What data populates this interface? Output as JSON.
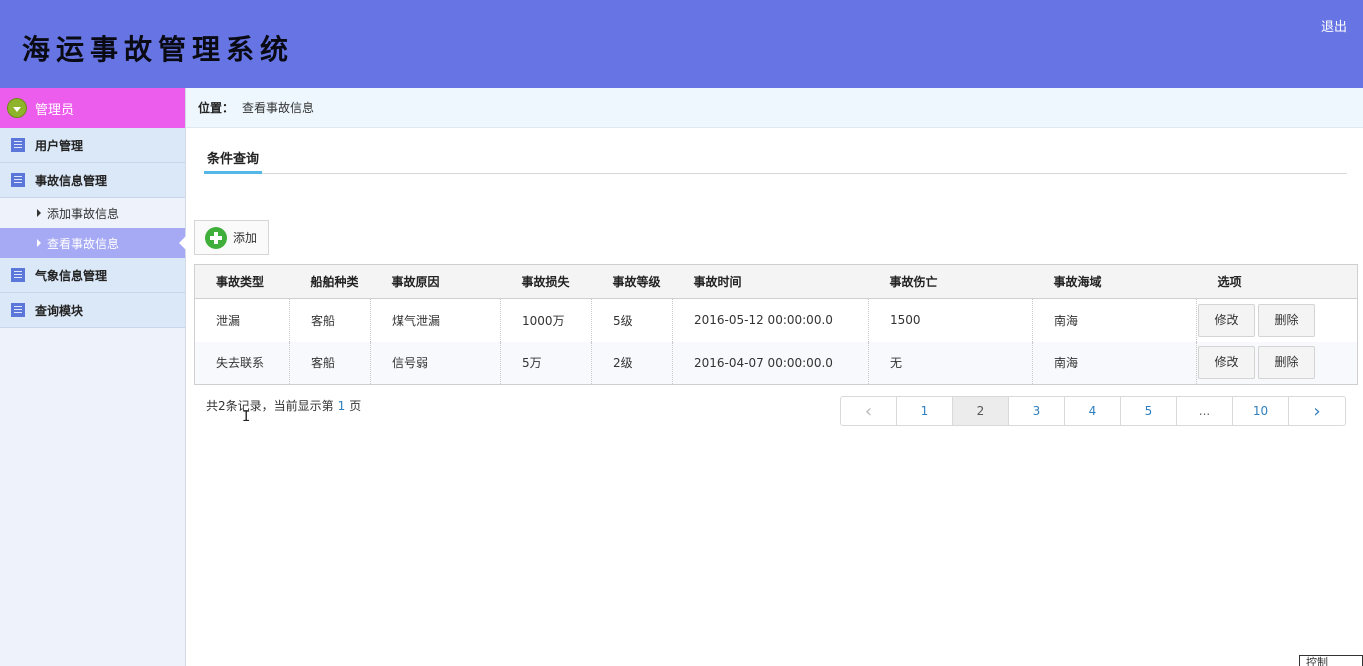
{
  "header": {
    "title": "海运事故管理系统",
    "logout": "退出"
  },
  "sidebar": {
    "user": "管理员",
    "menus": [
      {
        "label": "用户管理"
      },
      {
        "label": "事故信息管理"
      },
      {
        "label": "气象信息管理"
      },
      {
        "label": "查询模块"
      }
    ],
    "submenus": [
      {
        "label": "添加事故信息"
      },
      {
        "label": "查看事故信息"
      }
    ]
  },
  "breadcrumb": {
    "label": "位置：",
    "value": "查看事故信息"
  },
  "tab": "条件查询",
  "add_button": "添加",
  "table": {
    "headers": [
      "事故类型",
      "船舶种类",
      "事故原因",
      "事故损失",
      "事故等级",
      "事故时间",
      "事故伤亡",
      "事故海域",
      "选项"
    ],
    "rows": [
      [
        "泄漏",
        "客船",
        "煤气泄漏",
        "1000万",
        "5级",
        "2016-05-12 00:00:00.0",
        "1500",
        "南海"
      ],
      [
        "失去联系",
        "客船",
        "信号弱",
        "5万",
        "2级",
        "2016-04-07 00:00:00.0",
        "无",
        "南海"
      ]
    ],
    "edit_label": "修改",
    "delete_label": "删除"
  },
  "pagination": {
    "info_prefix": "共2条记录，当前显示第",
    "current": "1",
    "info_suffix": "页",
    "prev": "‹",
    "pages": [
      "1",
      "2",
      "3",
      "4",
      "5",
      "...",
      "10"
    ],
    "active_page": "2",
    "next": "›"
  },
  "corner_widget": "控制"
}
